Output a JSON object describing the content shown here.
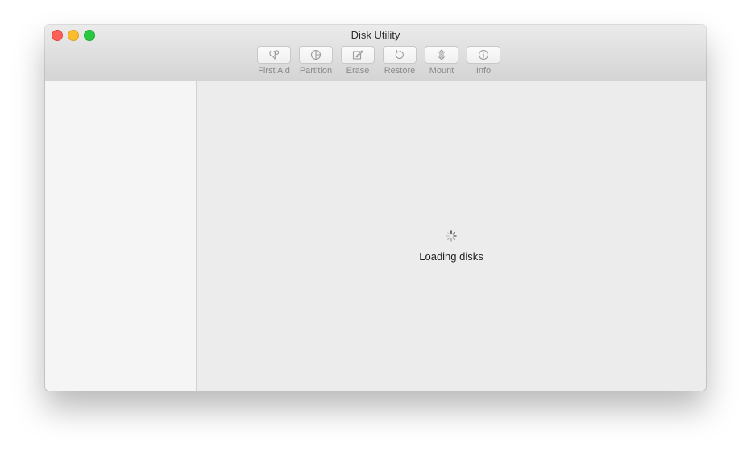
{
  "window": {
    "title": "Disk Utility"
  },
  "toolbar": {
    "items": [
      {
        "label": "First Aid",
        "icon": "stethoscope-icon"
      },
      {
        "label": "Partition",
        "icon": "partition-pie-icon"
      },
      {
        "label": "Erase",
        "icon": "erase-pencil-icon"
      },
      {
        "label": "Restore",
        "icon": "restore-arrow-icon"
      },
      {
        "label": "Mount",
        "icon": "mount-icon"
      },
      {
        "label": "Info",
        "icon": "info-icon"
      }
    ]
  },
  "main": {
    "status": "Loading disks"
  },
  "colors": {
    "close": "#fc5f57",
    "minimize": "#fdbc2e",
    "zoom": "#28c840",
    "window_bg": "#ececec",
    "sidebar_bg": "#f5f5f5"
  }
}
